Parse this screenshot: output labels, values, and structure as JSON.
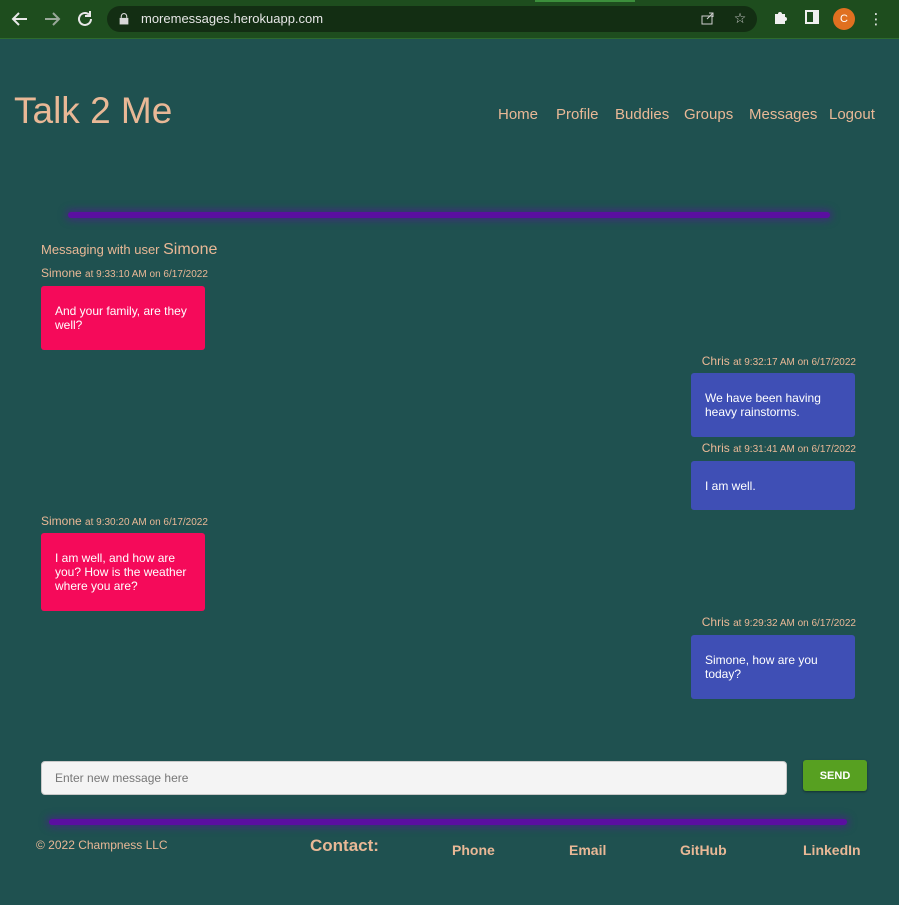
{
  "browser": {
    "url": "moremessages.herokuapp.com",
    "profile_initial": "C"
  },
  "site": {
    "title": "Talk 2 Me"
  },
  "nav": [
    "Home",
    "Profile",
    "Buddies",
    "Groups",
    "Messages",
    "Logout"
  ],
  "conversation": {
    "header_prefix": "Messaging with user",
    "buddy": "Simone",
    "messages": [
      {
        "author": "Simone",
        "time": "at 9:33:10 AM on 6/17/2022",
        "text": "And your family, are they well?"
      },
      {
        "author": "Chris",
        "time": "at 9:32:17 AM on 6/17/2022",
        "text": "We have been having heavy rainstorms."
      },
      {
        "author": "Chris",
        "time": "at 9:31:41 AM on 6/17/2022",
        "text": "I am well."
      },
      {
        "author": "Simone",
        "time": "at 9:30:20 AM on 6/17/2022",
        "text": "I am well, and how are you?  How is the weather where you are?"
      },
      {
        "author": "Chris",
        "time": "at 9:29:32 AM on 6/17/2022",
        "text": "Simone, how are you today?"
      }
    ]
  },
  "composer": {
    "placeholder": "Enter new message here",
    "send_label": "SEND"
  },
  "footer": {
    "copyright": "© 2022 Champness LLC",
    "contact_label": "Contact:",
    "links": [
      "Phone",
      "Email",
      "GitHub",
      "LinkedIn"
    ]
  },
  "colors": {
    "background": "#1f5150",
    "accent_text": "#e9b896",
    "incoming_bubble": "#f50a5a",
    "outgoing_bubble": "#3f4fb5",
    "divider": "#5a0fa0",
    "send_button": "#57a021"
  }
}
